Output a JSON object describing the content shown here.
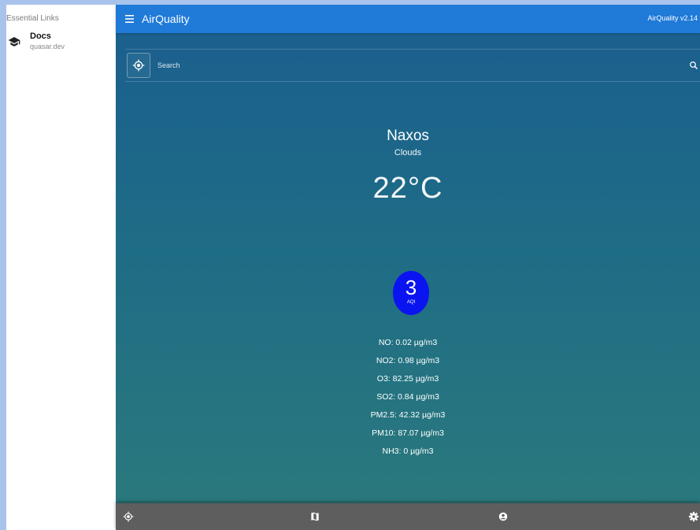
{
  "drawer": {
    "header": "Essential Links",
    "items": [
      {
        "title": "Docs",
        "caption": "quasar.dev",
        "icon": "school-icon"
      }
    ]
  },
  "header": {
    "menu_icon": "menu-icon",
    "title": "AirQuality",
    "version": "AirQuality v2.14"
  },
  "search": {
    "placeholder": "Search",
    "value": "",
    "locate_icon": "my-location-icon",
    "search_icon": "search-icon"
  },
  "weather": {
    "city": "Naxos",
    "condition": "Clouds",
    "temperature": "22°C"
  },
  "aqi": {
    "value": "3",
    "label": "AQI",
    "color": "#0a14f0"
  },
  "pollutants": [
    "NO: 0.02 µg/m3",
    "NO2: 0.98 µg/m3",
    "O3: 82.25 µg/m3",
    "SO2: 0.84 µg/m3",
    "PM2.5: 42.32 µg/m3",
    "PM10: 87.07 µg/m3",
    "NH3: 0 µg/m3"
  ],
  "footer": {
    "icons": [
      "my-location-icon",
      "map-icon",
      "account-icon",
      "settings-icon"
    ]
  },
  "colors": {
    "header": "#1f7ad8",
    "footer": "#5e5e5e",
    "background_top": "#1b5e8f",
    "background_bottom": "#2b7a7c"
  }
}
